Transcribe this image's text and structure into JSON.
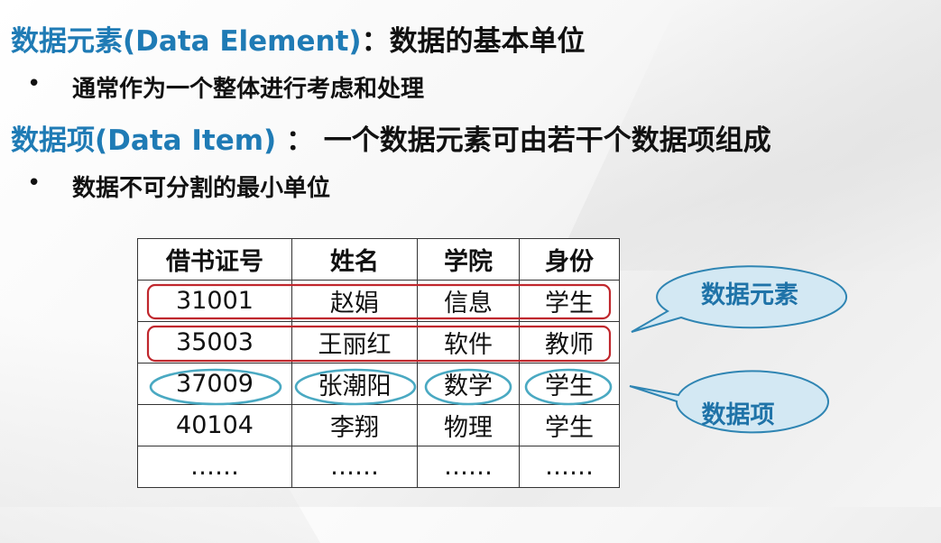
{
  "heading1": {
    "term": "数据元素(Data Element)",
    "sep": "：",
    "desc": "数据的基本单位"
  },
  "bullet_symbol": "•",
  "bullet1": "通常作为一个整体进行考虑和处理",
  "heading2": {
    "term": "数据项(Data Item)",
    "sep": " ： ",
    "desc": "一个数据元素可由若干个数据项组成"
  },
  "bullet2": "数据不可分割的最小单位",
  "table": {
    "headers": [
      "借书证号",
      "姓名",
      "学院",
      "身份"
    ],
    "rows": [
      [
        "31001",
        "赵娟",
        "信息",
        "学生"
      ],
      [
        "35003",
        "王丽红",
        "软件",
        "教师"
      ],
      [
        "37009",
        "张潮阳",
        "数学",
        "学生"
      ],
      [
        "40104",
        "李翔",
        "物理",
        "学生"
      ],
      [
        "……",
        "……",
        "……",
        "……"
      ]
    ]
  },
  "callouts": {
    "element": "数据元素",
    "item": "数据项"
  },
  "colors": {
    "term_blue": "#1f7bb5",
    "element_outline": "#c0272d",
    "item_outline": "#4aa9c2",
    "callout_fill": "#d3e8f3",
    "callout_stroke": "#2f85b3",
    "callout_text": "#1f73a8"
  }
}
